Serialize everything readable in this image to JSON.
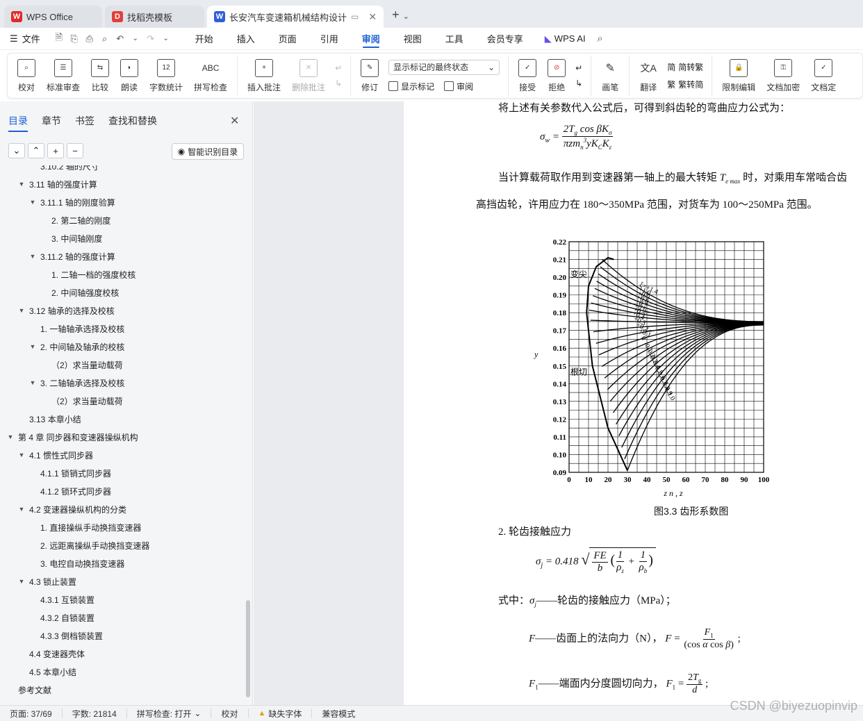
{
  "tabs": [
    {
      "label": "WPS Office",
      "logo": "W",
      "color": "#e02a2a"
    },
    {
      "label": "找稻壳模板",
      "logo": "D",
      "color": "#e0403a"
    },
    {
      "label": "长安汽车变速箱机械结构设计",
      "logo": "W",
      "color": "#2f5fd8"
    }
  ],
  "menu": {
    "file": "文件",
    "items": [
      "开始",
      "插入",
      "页面",
      "引用",
      "审阅",
      "视图",
      "工具",
      "会员专享"
    ],
    "active": "审阅",
    "ai": "WPS AI"
  },
  "ribbon": {
    "proofing": [
      "校对",
      "标准审查",
      "比较",
      "朗读",
      "字数统计",
      "拼写检查"
    ],
    "comments": {
      "insert": "插入批注",
      "delete": "删除批注"
    },
    "track": {
      "revise": "修订",
      "select_value": "显示标记的最终状态",
      "show_markup": "显示标记",
      "review": "审阅"
    },
    "changes": {
      "accept": "接受",
      "reject": "拒绝"
    },
    "pen": "画笔",
    "translate": {
      "translate": "翻译",
      "trad": "简转繁",
      "simp": "繁转简"
    },
    "protect": {
      "restrict": "限制编辑",
      "encrypt": "文档加密",
      "final": "文档定"
    }
  },
  "nav": {
    "tabs": [
      "目录",
      "章节",
      "书签",
      "查找和替换"
    ],
    "active_tab": "目录",
    "smart_button": "智能识别目录",
    "toc": [
      {
        "text": "3.10.2 轴的尺寸",
        "level": 3,
        "arrow": false
      },
      {
        "text": "3.11 轴的强度计算",
        "level": 2,
        "arrow": true
      },
      {
        "text": "3.11.1 轴的刚度验算",
        "level": 3,
        "arrow": true
      },
      {
        "text": "2. 第二轴的刚度",
        "level": 4,
        "arrow": false
      },
      {
        "text": "3. 中间轴刚度",
        "level": 4,
        "arrow": false
      },
      {
        "text": "3.11.2 轴的强度计算",
        "level": 3,
        "arrow": true
      },
      {
        "text": "1. 二轴一档的强度校核",
        "level": 4,
        "arrow": false
      },
      {
        "text": "2. 中间轴强度校核",
        "level": 4,
        "arrow": false
      },
      {
        "text": "3.12 轴承的选择及校核",
        "level": 2,
        "arrow": true
      },
      {
        "text": "1. 一轴轴承选择及校核",
        "level": 3,
        "arrow": false
      },
      {
        "text": "2. 中间轴及轴承的校核",
        "level": 3,
        "arrow": true
      },
      {
        "text": "（2）求当量动载荷",
        "level": 4,
        "arrow": false
      },
      {
        "text": "3. 二轴轴承选择及校核",
        "level": 3,
        "arrow": true
      },
      {
        "text": "（2）求当量动载荷",
        "level": 4,
        "arrow": false
      },
      {
        "text": "3.13 本章小结",
        "level": 2,
        "arrow": false
      },
      {
        "text": "第 4 章 同步器和变速器操纵机构",
        "level": 1,
        "arrow": true
      },
      {
        "text": "4.1 惯性式同步器",
        "level": 2,
        "arrow": true
      },
      {
        "text": "4.1.1 锁销式同步器",
        "level": 3,
        "arrow": false
      },
      {
        "text": "4.1.2 锁环式同步器",
        "level": 3,
        "arrow": false
      },
      {
        "text": "4.2 变速器操纵机构的分类",
        "level": 2,
        "arrow": true
      },
      {
        "text": "1. 直接操纵手动换挡变速器",
        "level": 3,
        "arrow": false
      },
      {
        "text": "2. 远距离操纵手动换挡变速器",
        "level": 3,
        "arrow": false
      },
      {
        "text": "3. 电控自动换挡变速器",
        "level": 3,
        "arrow": false
      },
      {
        "text": "4.3 锁止装置",
        "level": 2,
        "arrow": true
      },
      {
        "text": "4.3.1 互锁装置",
        "level": 3,
        "arrow": false
      },
      {
        "text": "4.3.2 自锁装置",
        "level": 3,
        "arrow": false
      },
      {
        "text": "4.3.3 倒档锁装置",
        "level": 3,
        "arrow": false
      },
      {
        "text": "4.4 变速器壳体",
        "level": 2,
        "arrow": false
      },
      {
        "text": "4.5 本章小结",
        "level": 2,
        "arrow": false
      },
      {
        "text": "参考文献",
        "level": 1,
        "arrow": false
      }
    ]
  },
  "doc": {
    "line_top": "将上述有关参数代入公式后，可得到斜齿轮的弯曲应力公式为：",
    "para1_a": "当计算载荷取作用到变速器第一轴上的最大转矩",
    "para1_b": "时，对乘用车常啮合齿",
    "para1_c": "高挡齿轮，许用应力在 180～350MPa 范围，对货车为 100～250MPa 范围。",
    "figure_caption": "图3.3  齿形系数图",
    "section2": "2. 轮齿接触应力",
    "where_a": "式中：",
    "where_b": "——轮齿的接触应力（MPa）；",
    "f_def": "——齿面上的法向力（N），",
    "f1_def": "——端面内分度圆切向力，"
  },
  "chart_data": {
    "type": "line",
    "title": "",
    "xlabel": "z n , z",
    "ylabel": "y",
    "xlim": [
      0,
      100
    ],
    "ylim": [
      0.09,
      0.22
    ],
    "x_ticks": [
      "0",
      "10",
      "20",
      "30",
      "40",
      "50",
      "60",
      "70",
      "80",
      "90",
      "100"
    ],
    "y_ticks": [
      "0.09",
      "0.10",
      "0.11",
      "0.12",
      "0.13",
      "0.14",
      "0.15",
      "0.16",
      "0.17",
      "0.18",
      "0.19",
      "0.20",
      "0.21",
      "0.22"
    ],
    "region_labels": [
      "变尖",
      "根切"
    ],
    "curve_labels": [
      "ξ=+1.4",
      "+1.0",
      "+0.9",
      "+0.8",
      "+0.7",
      "+0.6",
      "+0.5",
      "+0.4",
      "+0.3",
      "+0.2",
      "+0.1",
      "0",
      "-0.1",
      "-0.2",
      "-0.3",
      "-0.4",
      "-0.5",
      "-0.6",
      "-0.7",
      "-0.8",
      "-0.9",
      "-1.0"
    ],
    "converge": {
      "x": 100,
      "y": 0.174
    }
  },
  "status": {
    "page": "页面: 37/69",
    "words": "字数: 21814",
    "spell": "拼写检查: 打开",
    "proof": "校对",
    "missing_font": "缺失字体",
    "compat": "兼容模式"
  },
  "watermark": "CSDN @biyezuopinvip"
}
